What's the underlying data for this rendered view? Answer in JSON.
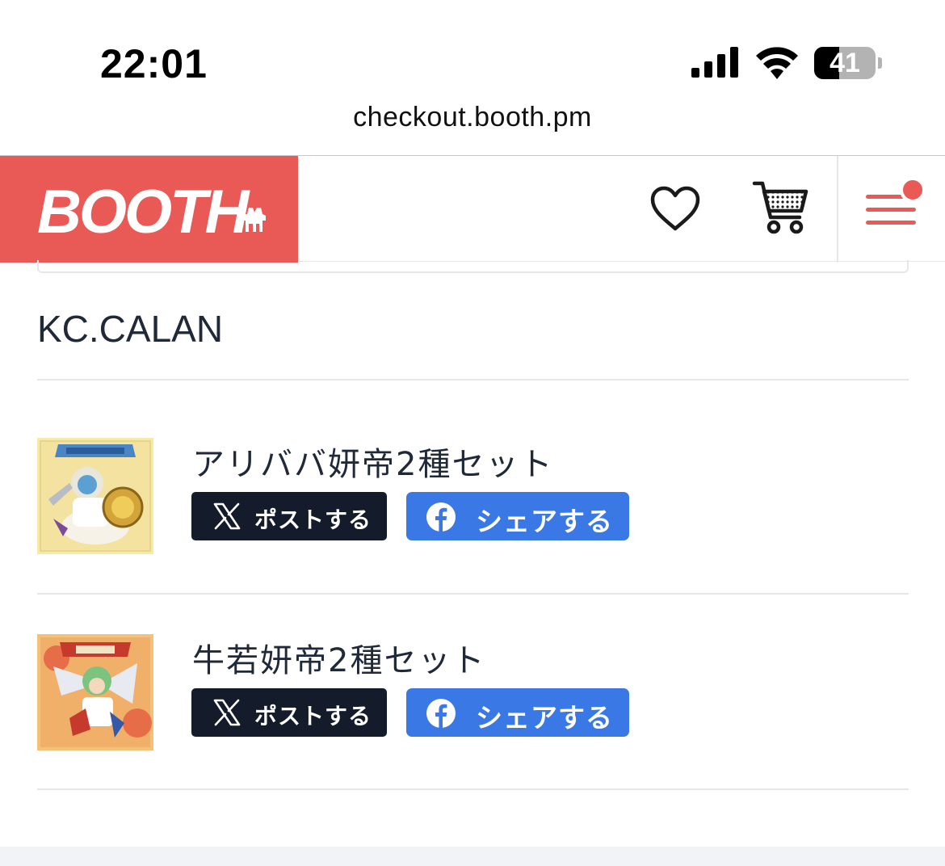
{
  "status_bar": {
    "time": "22:01",
    "battery_percent": "41",
    "battery_level": 0.41
  },
  "browser": {
    "url": "checkout.booth.pm"
  },
  "header": {
    "logo_text": "BOOTH",
    "brand_color": "#e95a57",
    "icons": [
      "heart-icon",
      "cart-icon",
      "menu-icon"
    ],
    "menu_badge_color": "#e95a57"
  },
  "shop": {
    "name": "KC.CALAN"
  },
  "items": [
    {
      "title": "アリババ妍帝2種セット",
      "post_label": "ポストする",
      "share_label": "シェアする"
    },
    {
      "title": "牛若妍帝2種セット",
      "post_label": "ポストする",
      "share_label": "シェアする"
    }
  ],
  "colors": {
    "x_button": "#141b2b",
    "facebook_button": "#3a78e5",
    "divider": "#e5e7eb"
  }
}
